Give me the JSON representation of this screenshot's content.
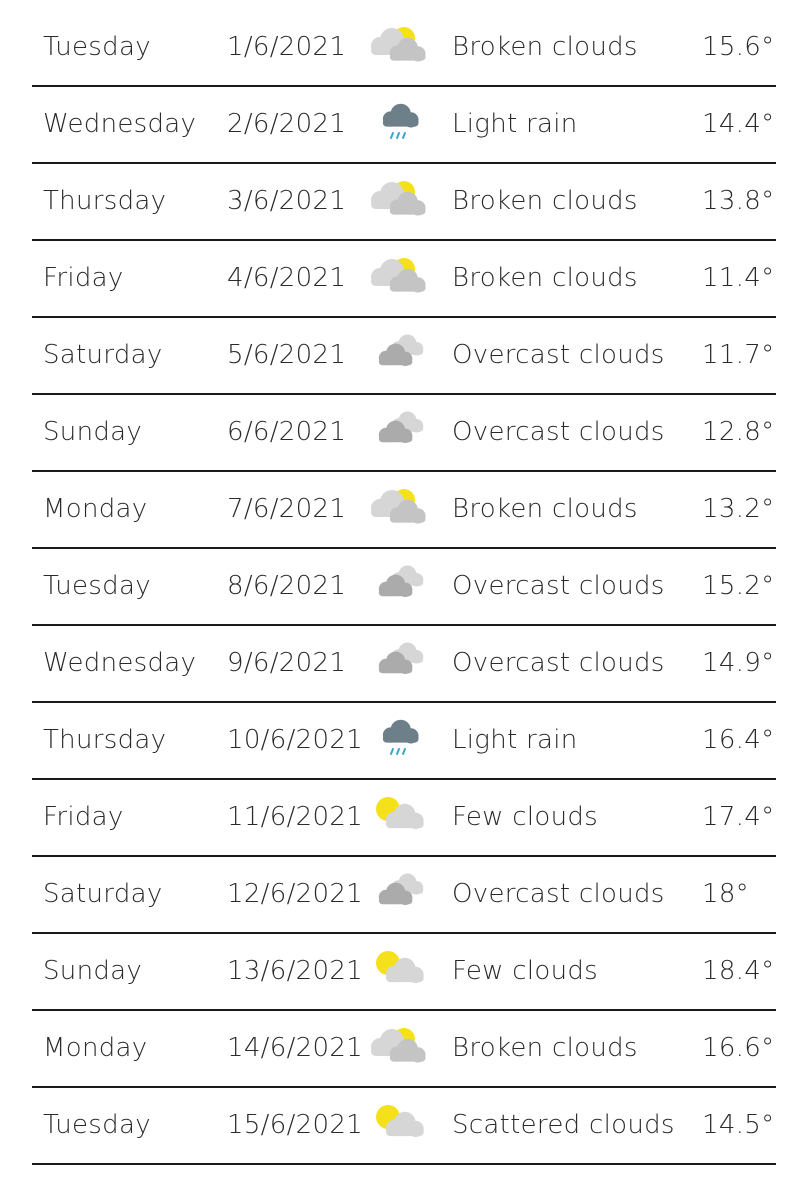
{
  "forecast": [
    {
      "day": "Tuesday",
      "date": "1/6/2021",
      "icon": "broken-clouds-icon",
      "description": "Broken clouds",
      "temperature": "15.6°"
    },
    {
      "day": "Wednesday",
      "date": "2/6/2021",
      "icon": "light-rain-icon",
      "description": "Light rain",
      "temperature": "14.4°"
    },
    {
      "day": "Thursday",
      "date": "3/6/2021",
      "icon": "broken-clouds-icon",
      "description": "Broken clouds",
      "temperature": "13.8°"
    },
    {
      "day": "Friday",
      "date": "4/6/2021",
      "icon": "broken-clouds-icon",
      "description": "Broken clouds",
      "temperature": "11.4°"
    },
    {
      "day": "Saturday",
      "date": "5/6/2021",
      "icon": "overcast-clouds-icon",
      "description": "Overcast clouds",
      "temperature": "11.7°"
    },
    {
      "day": "Sunday",
      "date": "6/6/2021",
      "icon": "overcast-clouds-icon",
      "description": "Overcast clouds",
      "temperature": "12.8°"
    },
    {
      "day": "Monday",
      "date": "7/6/2021",
      "icon": "broken-clouds-icon",
      "description": "Broken clouds",
      "temperature": "13.2°"
    },
    {
      "day": "Tuesday",
      "date": "8/6/2021",
      "icon": "overcast-clouds-icon",
      "description": "Overcast clouds",
      "temperature": "15.2°"
    },
    {
      "day": "Wednesday",
      "date": "9/6/2021",
      "icon": "overcast-clouds-icon",
      "description": "Overcast clouds",
      "temperature": "14.9°"
    },
    {
      "day": "Thursday",
      "date": "10/6/2021",
      "icon": "light-rain-icon",
      "description": "Light rain",
      "temperature": "16.4°"
    },
    {
      "day": "Friday",
      "date": "11/6/2021",
      "icon": "few-clouds-icon",
      "description": "Few clouds",
      "temperature": "17.4°"
    },
    {
      "day": "Saturday",
      "date": "12/6/2021",
      "icon": "overcast-clouds-icon",
      "description": "Overcast clouds",
      "temperature": "18°"
    },
    {
      "day": "Sunday",
      "date": "13/6/2021",
      "icon": "few-clouds-icon",
      "description": "Few clouds",
      "temperature": "18.4°"
    },
    {
      "day": "Monday",
      "date": "14/6/2021",
      "icon": "broken-clouds-icon",
      "description": "Broken clouds",
      "temperature": "16.6°"
    },
    {
      "day": "Tuesday",
      "date": "15/6/2021",
      "icon": "scattered-clouds-icon",
      "description": "Scattered clouds",
      "temperature": "14.5°"
    }
  ],
  "colors": {
    "sun": "#f5e11a",
    "cloud_light": "#d6d6d6",
    "cloud_mid": "#c4c4c4",
    "cloud_dark": "#ababab",
    "rain_cloud": "#6d7f88",
    "rain_drops": "#3fa3c7",
    "divider": "#1a1a1a"
  }
}
